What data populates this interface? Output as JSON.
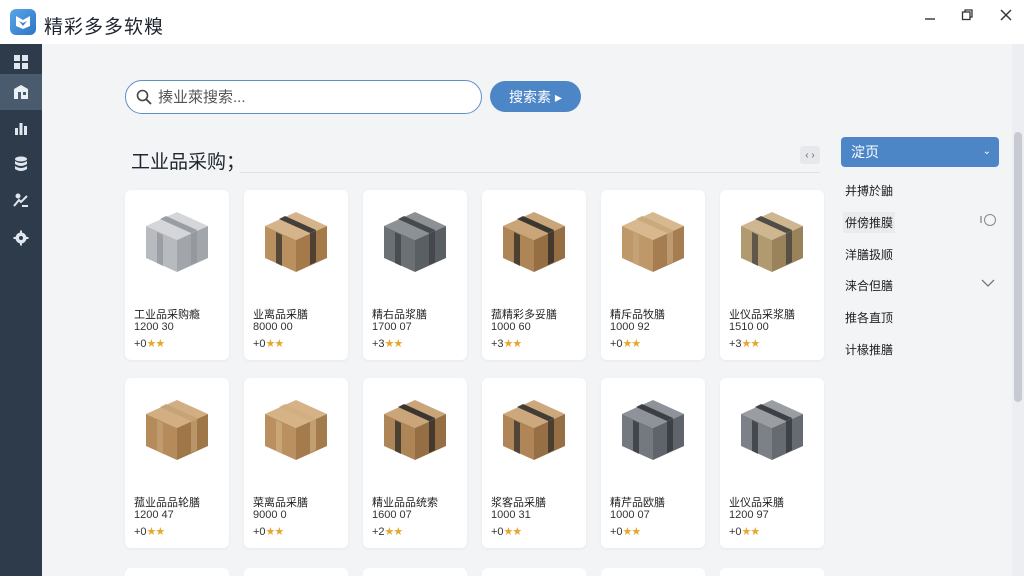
{
  "window": {
    "title": "精彩多多软糗",
    "controls": {
      "minimize": "–",
      "restore": "❐",
      "close": "✕"
    }
  },
  "sidebar": {
    "items": [
      {
        "icon": "grid-icon"
      },
      {
        "icon": "store-icon",
        "active": true
      },
      {
        "icon": "bar-chart-icon"
      },
      {
        "icon": "database-icon"
      },
      {
        "icon": "tools-icon"
      },
      {
        "icon": "settings-icon"
      }
    ]
  },
  "search": {
    "placeholder": "揍业萊搜索...",
    "button_label": "搜索素 ▸"
  },
  "section": {
    "title": "工业品采购；",
    "collapse_label": "‹ ›"
  },
  "products": [
    {
      "name": "工业品采购瘾",
      "price": "1200 30",
      "rating_prefix": "+0",
      "stars": "★★",
      "box": "gray"
    },
    {
      "name": "业离品采膳",
      "price": "8000 00",
      "rating_prefix": "+0",
      "stars": "★★",
      "box": "brown-tape"
    },
    {
      "name": "精右品浆膳",
      "price": "1700 07",
      "rating_prefix": "+3",
      "stars": "★★",
      "box": "machine"
    },
    {
      "name": "菰精彩多妥膳",
      "price": "1000 60",
      "rating_prefix": "+3",
      "stars": "★★",
      "box": "brown-dark"
    },
    {
      "name": "精斥品牧膳",
      "price": "1000 92",
      "rating_prefix": "+0",
      "stars": "★★",
      "box": "brown-label"
    },
    {
      "name": "业仪品采浆膳",
      "price": "1510 00",
      "rating_prefix": "+3",
      "stars": "★★",
      "box": "open"
    },
    {
      "name": "菰业品品轮膳",
      "price": "1200 47",
      "rating_prefix": "+0",
      "stars": "★★",
      "box": "brown"
    },
    {
      "name": "菜离品采膳",
      "price": "9000 0",
      "rating_prefix": "+0",
      "stars": "★★",
      "box": "brown-plain"
    },
    {
      "name": "精业品品统索",
      "price": "1600 07",
      "rating_prefix": "+2",
      "stars": "★★",
      "box": "brown-dark"
    },
    {
      "name": "浆客品采膳",
      "price": "1000 31",
      "rating_prefix": "+0",
      "stars": "★★",
      "box": "brown-dark2"
    },
    {
      "name": "精芹品欧膳",
      "price": "1000 07",
      "rating_prefix": "+0",
      "stars": "★★",
      "box": "metal"
    },
    {
      "name": "业仪品采膳",
      "price": "1200 97",
      "rating_prefix": "+0",
      "stars": "★★",
      "box": "metal2"
    }
  ],
  "filters": {
    "dropdown_label": "淀页",
    "items": [
      {
        "label": "并搏於鼬"
      },
      {
        "label": "併傍推膜",
        "selected": true
      },
      {
        "label": "洋膳扱顺"
      },
      {
        "label": "涞合但膳"
      },
      {
        "label": "推各直顶"
      },
      {
        "label": "计椽推膳"
      }
    ]
  },
  "colors": {
    "accent": "#4d86c6",
    "sidebar": "#2d3b4b",
    "star": "#e4a72a"
  }
}
